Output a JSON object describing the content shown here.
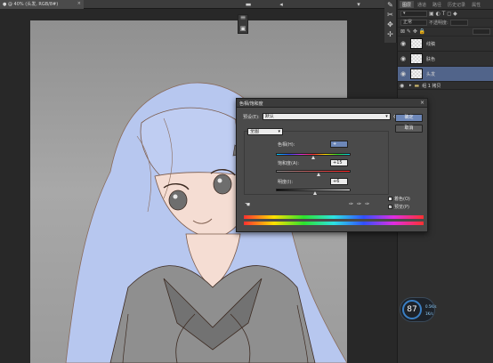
{
  "document_tab": {
    "title": "● @ 40% (头发, RGB/8#)",
    "close": "×"
  },
  "dialog": {
    "title": "色相/饱和度",
    "preset_label": "预设(E):",
    "preset_value": "默认",
    "ok": "确定",
    "cancel": "取消",
    "channel": "全图",
    "hue_label": "色相(H):",
    "hue_value": "+",
    "saturation_label": "饱和度(A):",
    "saturation_value": "+15",
    "lightness_label": "明度(I):",
    "lightness_value": "+6",
    "colorize_label": "着色(O)",
    "preview_label": "预览(P)",
    "preview_checked": "✓"
  },
  "layers": [
    {
      "name": "线稿",
      "selected": false
    },
    {
      "name": "肤色",
      "selected": false
    },
    {
      "name": "头发",
      "selected": true
    }
  ],
  "group": {
    "name": "组 1 拷贝"
  },
  "panel_tabs": [
    "图层",
    "通道",
    "路径",
    "历史记录",
    "属性"
  ],
  "panel_row": {
    "blend": "正常",
    "opacity_label": "不透明度:"
  },
  "gauge": {
    "percent": "87",
    "up": "0.5K/s",
    "down": "1K/s"
  },
  "colors": {
    "hair": "#b7c7ef",
    "line": "#7a5a4a",
    "canvas": "#9c9c9c",
    "selected_layer": "#51648a",
    "accent": "#6d87b8"
  }
}
